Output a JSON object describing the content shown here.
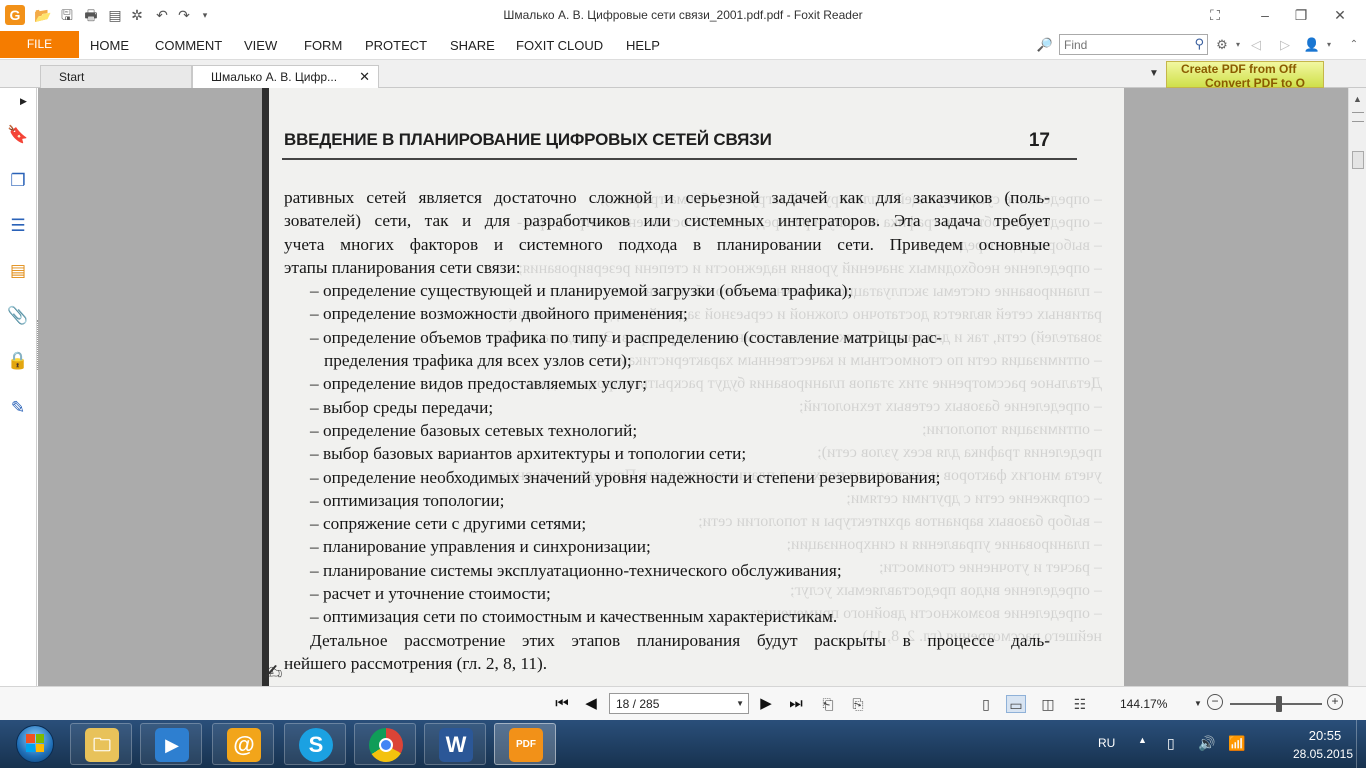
{
  "window": {
    "title": "Шмалько А. В. Цифровые сети связи_2001.pdf.pdf - Foxit Reader",
    "logo_icon": "foxit-g-logo"
  },
  "menu": {
    "file": "FILE",
    "items": [
      "HOME",
      "COMMENT",
      "VIEW",
      "FORM",
      "PROTECT",
      "SHARE",
      "FOXIT CLOUD",
      "HELP"
    ]
  },
  "search": {
    "placeholder": "Find",
    "value": ""
  },
  "tabs": [
    {
      "label": "Start"
    },
    {
      "label": "Шмалько А. В. Цифр...",
      "active": true
    }
  ],
  "ad": {
    "line1": "Create PDF from Off",
    "line2": "Convert PDF to O"
  },
  "document": {
    "header": "ВВЕДЕНИЕ В ПЛАНИРОВАНИЕ ЦИФРОВЫХ СЕТЕЙ СВЯЗИ",
    "page_number": "17",
    "intro": [
      "ративных сетей является достаточно сложной и серьезной задачей как для заказчиков (поль-",
      "зователей) сети, так и для разработчиков или системных интеграторов. Эта задача требует",
      "учета многих факторов и системного подхода в планировании сети. Приведем основные"
    ],
    "intro_last": "этапы планирования сети связи:",
    "bullets": [
      "– определение существующей и планируемой загрузки (объема трафика);",
      "– определение возможности двойного применения;",
      "– определение объемов трафика по типу и распределению (составление матрицы рас-",
      "пределения трафика для всех узлов сети);",
      "– определение видов предоставляемых услуг;",
      "– выбор среды передачи;",
      "– определение базовых сетевых технологий;",
      "– выбор базовых вариантов архитектуры и топологии сети;",
      "– определение необходимых значений уровня надежности и степени резервирования;",
      "– оптимизация топологии;",
      "– сопряжение сети с другими сетями;",
      "– планирование управления и синхронизации;",
      "– планирование системы эксплуатационно-технического обслуживания;",
      "– расчет и уточнение стоимости;",
      "– оптимизация сети по стоимостным и качественным характеристикам."
    ],
    "closing_line1": "Детальное рассмотрение этих этапов планирования будут раскрыты в процессе даль-",
    "closing_line2": "нейшего рассмотрения (гл. 2, 8, 11)."
  },
  "navigation": {
    "page_value": "18 / 285",
    "zoom": "144.17%"
  },
  "taskbar": {
    "apps": [
      {
        "name": "explorer",
        "icon": "folder-icon"
      },
      {
        "name": "media-player",
        "icon": "media-play-icon"
      },
      {
        "name": "mail",
        "icon": "at-sign-icon",
        "glyph": "@"
      },
      {
        "name": "skype",
        "icon": "skype-icon",
        "glyph": "S"
      },
      {
        "name": "chrome",
        "icon": "chrome-icon"
      },
      {
        "name": "word",
        "icon": "word-icon",
        "glyph": "W"
      },
      {
        "name": "foxit",
        "icon": "foxit-pdf-icon",
        "glyph": "PDF",
        "active": true
      }
    ],
    "language": "RU",
    "time": "20:55",
    "date": "28.05.2015"
  },
  "colors": {
    "file_tab": "#f57c00",
    "document_bg": "#ababab",
    "page_bg": "#f1f1ef",
    "taskbar": "#1f4168"
  }
}
